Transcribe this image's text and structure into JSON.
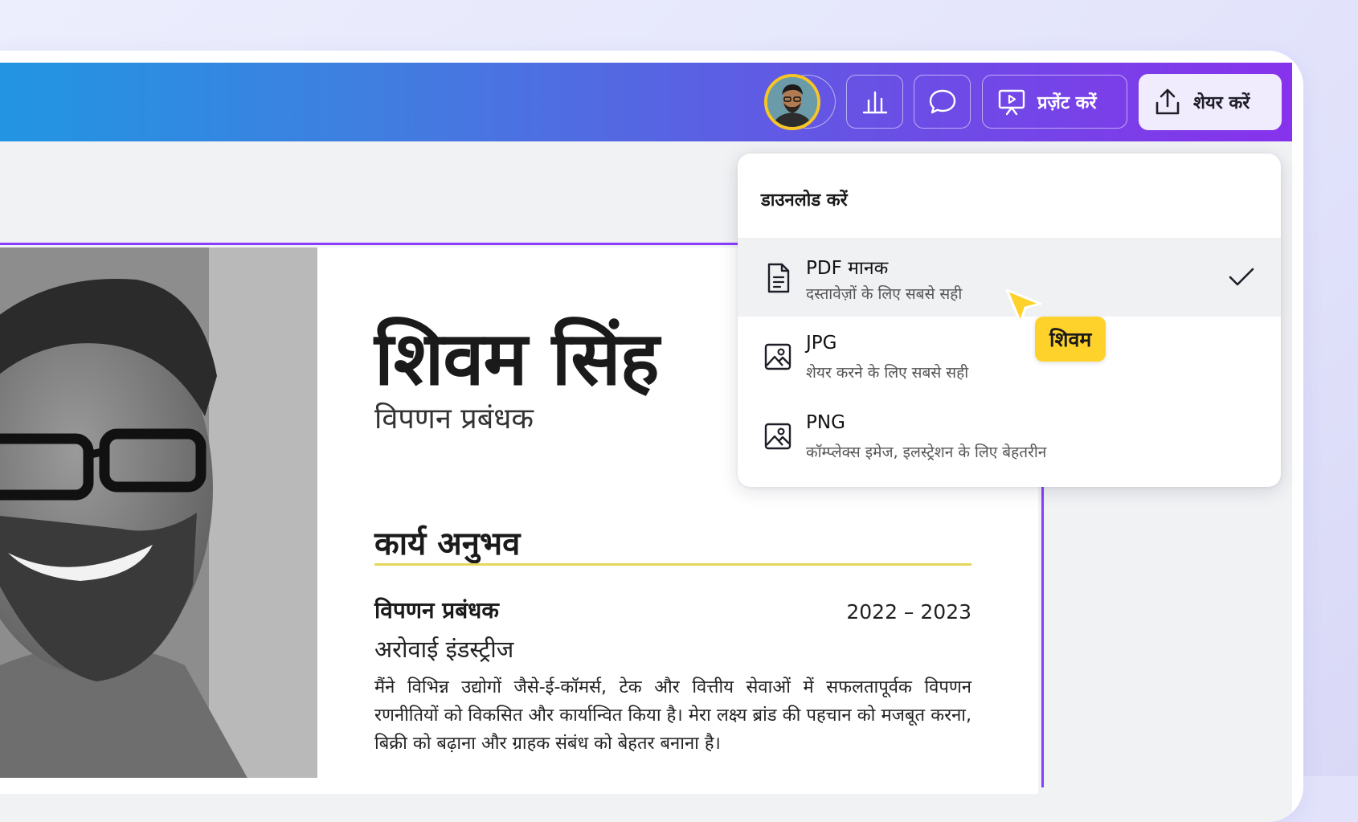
{
  "toolbar": {
    "add_icon": "plus-icon",
    "insights_icon": "bar-chart-icon",
    "comment_icon": "comment-icon",
    "present_label": "प्रज़ेंट करें",
    "present_icon": "presentation-icon",
    "share_label": "शेयर करें",
    "share_icon": "upload-icon"
  },
  "download_menu": {
    "heading": "डाउनलोड करें",
    "options": [
      {
        "label": "PDF मानक",
        "description": "दस्तावेज़ों के लिए सबसे सही",
        "icon": "document-icon",
        "selected": true
      },
      {
        "label": "JPG",
        "description": "शेयर करने के लिए सबसे सही",
        "icon": "image-icon",
        "selected": false
      },
      {
        "label": "PNG",
        "description": "कॉम्प्लेक्स इमेज, इलस्ट्रेशन के लिए बेहतरीन",
        "icon": "image-icon",
        "selected": false
      }
    ]
  },
  "collaborator": {
    "cursor_label": "शिवम",
    "cursor_color": "#fed22b"
  },
  "resume": {
    "name": "शिवम सिंह",
    "title": "विपणन प्रबंधक",
    "section_heading": "कार्य अनुभव",
    "job": {
      "role": "विपणन प्रबंधक",
      "dates": "2022 – 2023",
      "company": "अरोवाई इंडस्ट्रीज",
      "description": "मैंने विभिन्न उद्योगों जैसे-ई-कॉमर्स, टेक और वित्तीय सेवाओं में सफलतापूर्वक विपणन रणनीतियों को विकसित और कार्यान्वित किया है। मेरा लक्ष्य ब्रांड की पहचान को मजबूत करना, बिक्री को बढ़ाना और ग्राहक संबंध को बेहतर बनाना है।"
    }
  },
  "colors": {
    "accent": "#8b3dff",
    "header_gradient_start": "#1f97e2",
    "header_gradient_end": "#8732ec",
    "section_rule": "#e6d75a",
    "avatar_ring": "#f6c624"
  }
}
